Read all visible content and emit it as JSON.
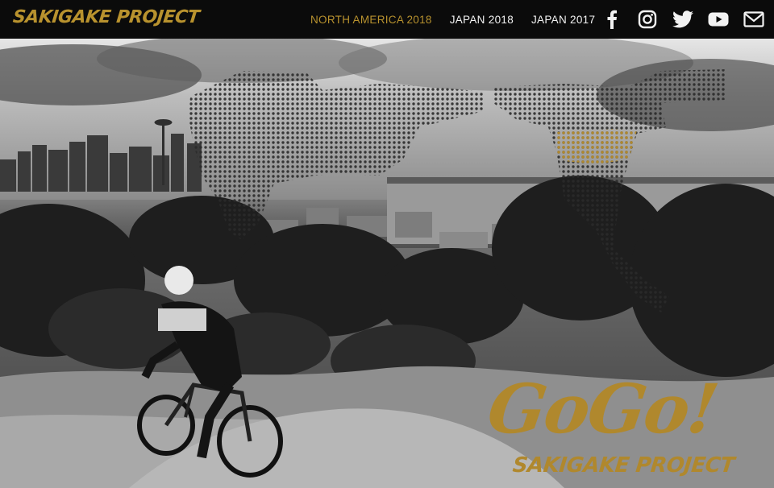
{
  "header": {
    "logo_text": "SAKIGAKE PROJECT",
    "nav": [
      {
        "label": "NORTH AMERICA 2018",
        "active": true
      },
      {
        "label": "JAPAN 2018",
        "active": false
      },
      {
        "label": "JAPAN 2017",
        "active": false
      }
    ],
    "social": [
      "facebook-icon",
      "instagram-icon",
      "twitter-icon",
      "youtube-icon",
      "mail-icon"
    ]
  },
  "hero": {
    "logo_main": "GoGo!",
    "logo_sub": "SAKIGAKE PROJECT"
  },
  "colors": {
    "accent": "#b8922e",
    "nav_text": "#f2f2f2",
    "bar": "#0b0b0b"
  }
}
